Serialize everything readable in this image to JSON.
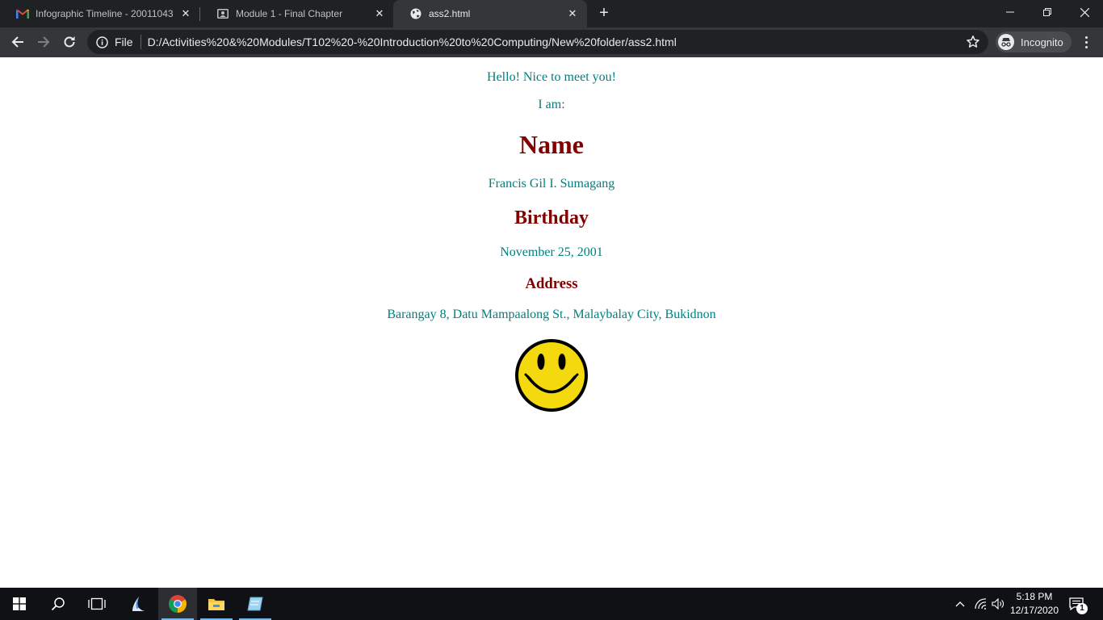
{
  "browser": {
    "tabs": [
      {
        "title": "Infographic Timeline - 20011043",
        "icon": "gmail-icon",
        "active": false
      },
      {
        "title": "Module 1 - Final Chapter",
        "icon": "classroom-icon",
        "active": false
      },
      {
        "title": "ass2.html",
        "icon": "globe-icon",
        "active": true
      }
    ],
    "address_bar": {
      "scheme_chip": "File",
      "url": "D:/Activities%20&%20Modules/T102%20-%20Introduction%20to%20Computing/New%20folder/ass2.html"
    },
    "profile_label": "Incognito"
  },
  "page": {
    "greeting": "Hello! Nice to meet you!",
    "intro": "I am:",
    "name_heading": "Name",
    "name_value": "Francis Gil I. Sumagang",
    "birthday_heading": "Birthday",
    "birthday_value": "November 25, 2001",
    "address_heading": "Address",
    "address_value": "Barangay 8, Datu Mampaalong St., Malaybalay City, Bukidnon",
    "image_icon": "smiley-face-icon",
    "colors": {
      "text": "#008080",
      "headings": "#800000",
      "smiley_fill": "#f5d90f"
    }
  },
  "taskbar": {
    "apps": [
      "start-icon",
      "search-icon",
      "task-view-icon",
      "app-icon",
      "chrome-icon",
      "file-explorer-icon",
      "notepad-icon"
    ],
    "time": "5:18 PM",
    "date": "12/17/2020",
    "notification_count": "1"
  }
}
